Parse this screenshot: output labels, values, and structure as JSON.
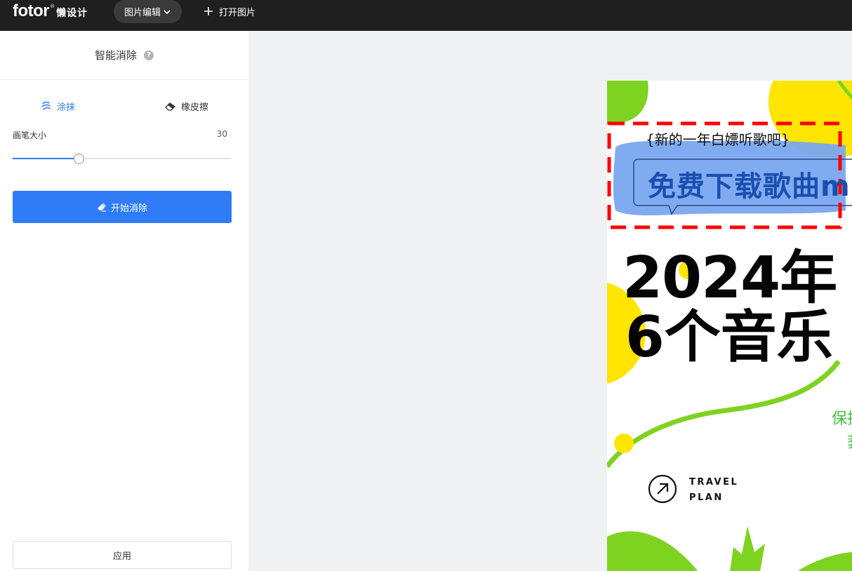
{
  "app": {
    "logo_text": "fotor",
    "logo_reg": "®",
    "logo_sub": "懒设计",
    "menu_label": "图片编辑",
    "open_label": "打开图片"
  },
  "panel": {
    "title": "智能消除",
    "help": "?",
    "tabs": [
      {
        "label": "涂抹",
        "active": true
      },
      {
        "label": "橡皮擦",
        "active": false
      }
    ],
    "brush_label": "画笔大小",
    "brush_value": "30",
    "brush_fraction": 0.3,
    "start_label": "开始消除",
    "apply_label": "应用"
  },
  "poster": {
    "subtitle": "{新的一年白嫖听歌吧}",
    "promo": "免费下载歌曲mp",
    "headline_line1": "2024年",
    "headline_line2": "6个音乐",
    "side_line1": "保排",
    "side_line2": "莾",
    "brand_line1": "TRAVEL",
    "brand_line2": "PLAN"
  },
  "colors": {
    "accent": "#2f7cf6",
    "topbar": "#1f1f1f",
    "poster_green": "#7ed321",
    "poster_yellow": "#ffe500",
    "selection_red": "#ff0000",
    "mask_blue": "#7aa7f0"
  }
}
